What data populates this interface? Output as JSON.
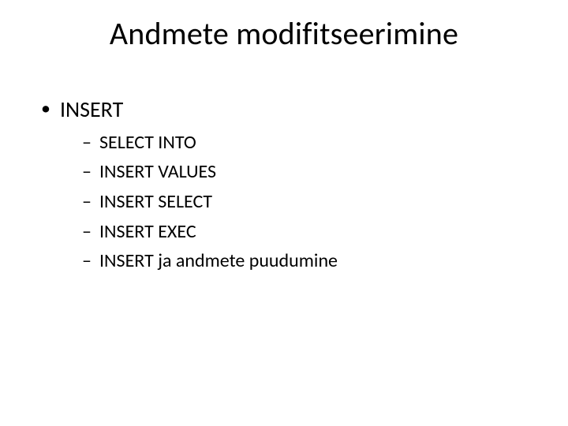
{
  "title": "Andmete modifitseerimine",
  "bullets": {
    "level1": [
      {
        "label": "INSERT",
        "children": [
          "SELECT INTO",
          "INSERT VALUES",
          "INSERT SELECT",
          "INSERT EXEC",
          "INSERT ja andmete puudumine"
        ]
      }
    ]
  }
}
